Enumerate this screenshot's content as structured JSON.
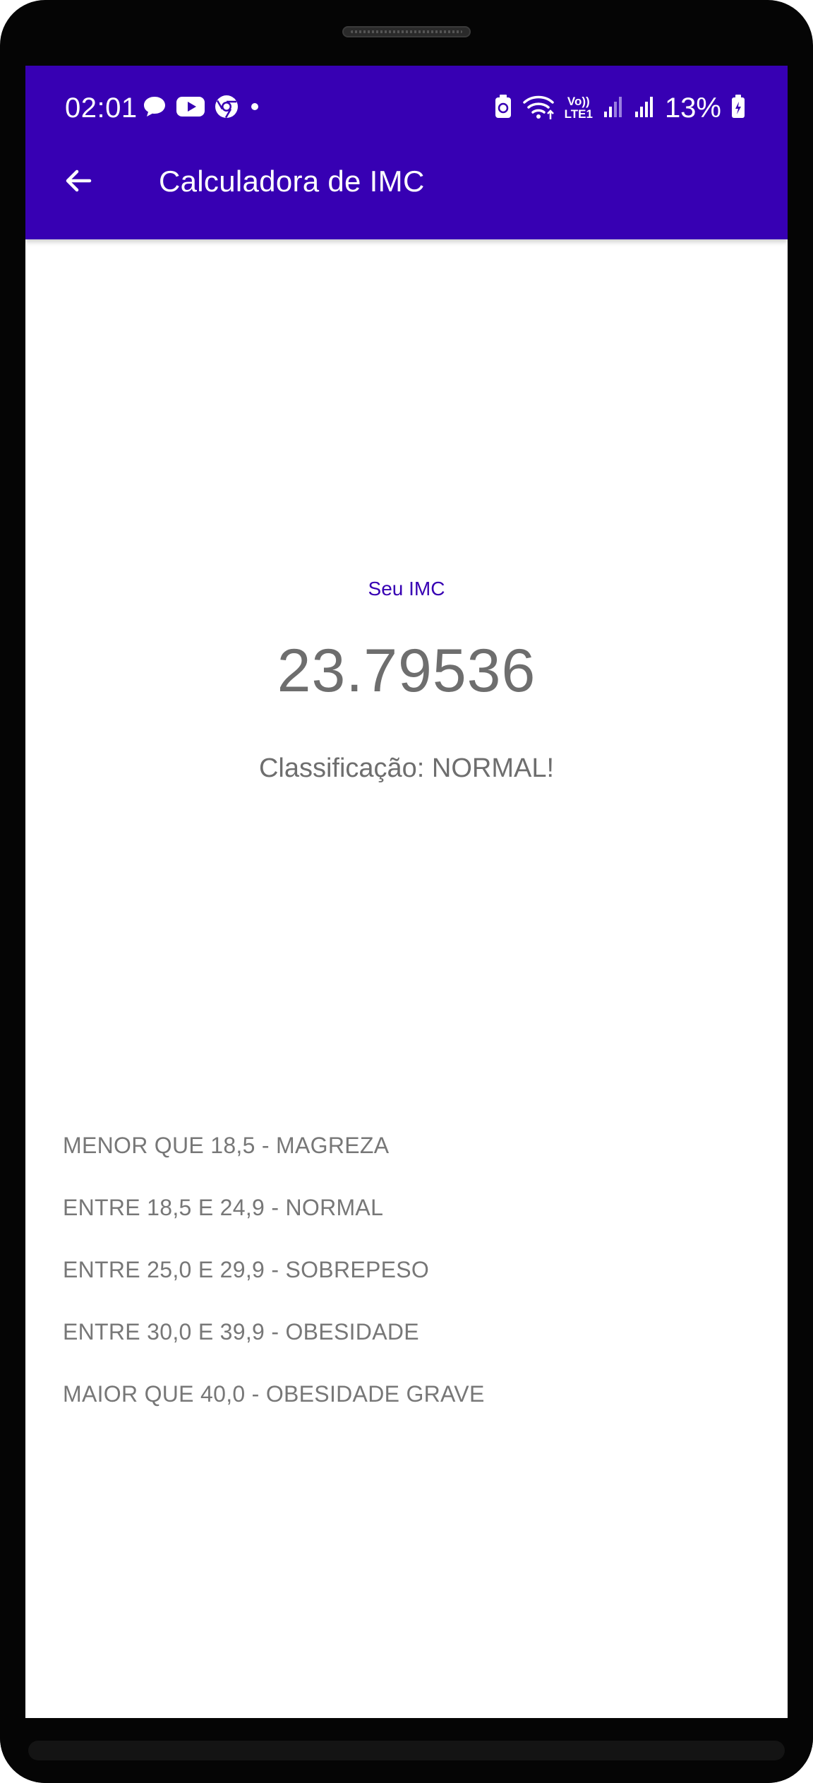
{
  "status_bar": {
    "time": "02:01",
    "battery": "13%",
    "network_label_top": "Vo))",
    "network_label_bottom": "LTE1",
    "left_icons": [
      "chat-bubble-icon",
      "youtube-icon",
      "chrome-icon",
      "dot-icon"
    ],
    "right_icons": [
      "battery-saver-icon",
      "wifi-icon",
      "signal-icon",
      "signal-icon",
      "battery-charging-icon"
    ]
  },
  "app_bar": {
    "title": "Calculadora de IMC",
    "back_icon": "arrow-back-icon",
    "color": "#3700b3"
  },
  "result": {
    "label": "Seu IMC",
    "value": "23.79536",
    "classification": "Classificação: NORMAL!"
  },
  "ranges": [
    "MENOR QUE 18,5 - MAGREZA",
    "ENTRE 18,5 E 24,9 - NORMAL",
    "ENTRE 25,0 E 29,9 - SOBREPESO",
    "ENTRE 30,0 E 39,9 - OBESIDADE",
    "MAIOR QUE 40,0 - OBESIDADE GRAVE"
  ]
}
